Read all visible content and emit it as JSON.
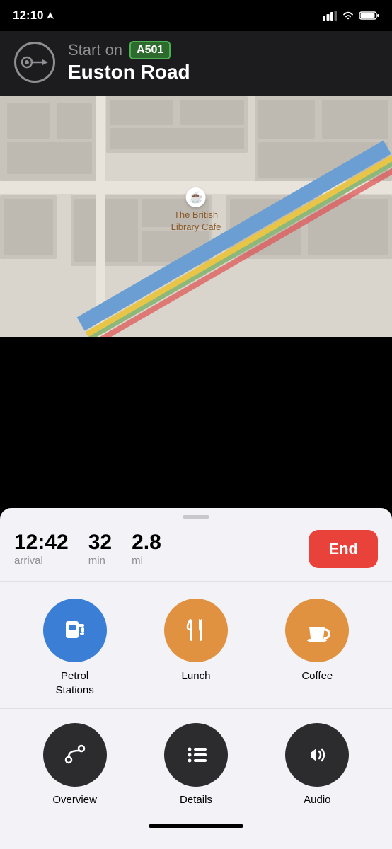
{
  "status_bar": {
    "time": "12:10",
    "signal_bars": 3,
    "wifi": true,
    "battery": "full"
  },
  "nav_header": {
    "start_label": "Start on",
    "road_badge": "A501",
    "road_name": "Euston Road"
  },
  "map": {
    "poi_label": "The British\nLibrary Cafe",
    "poi_icon": "☕"
  },
  "trip_info": {
    "arrival_time": "12:42",
    "arrival_label": "arrival",
    "duration_value": "32",
    "duration_label": "min",
    "distance_value": "2.8",
    "distance_label": "mi",
    "end_button_label": "End"
  },
  "categories": [
    {
      "id": "petrol",
      "label": "Petrol\nStations",
      "color": "blue"
    },
    {
      "id": "lunch",
      "label": "Lunch",
      "color": "orange"
    },
    {
      "id": "coffee",
      "label": "Coffee",
      "color": "orange"
    }
  ],
  "actions": [
    {
      "id": "overview",
      "label": "Overview",
      "color": "dark"
    },
    {
      "id": "details",
      "label": "Details",
      "color": "dark"
    },
    {
      "id": "audio",
      "label": "Audio",
      "color": "dark"
    }
  ]
}
